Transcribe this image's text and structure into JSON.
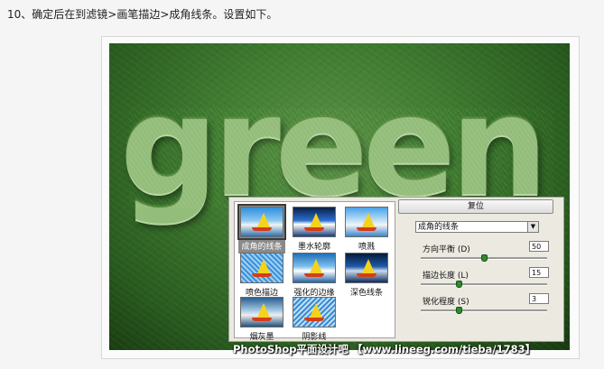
{
  "caption": "10、确定后在到滤镜>画笔描边>成角线条。设置如下。",
  "artwork": {
    "word": "green",
    "colors": {
      "background": "#3f7a30",
      "letters": "#93bd7a"
    }
  },
  "dialog": {
    "thumbnails": [
      {
        "label": "成角的线条",
        "selected": true
      },
      {
        "label": "墨水轮廓",
        "selected": false
      },
      {
        "label": "喷溅",
        "selected": false
      },
      {
        "label": "喷色描边",
        "selected": false
      },
      {
        "label": "强化的边缘",
        "selected": false
      },
      {
        "label": "深色线条",
        "selected": false
      },
      {
        "label": "烟灰墨",
        "selected": false
      },
      {
        "label": "阴影线",
        "selected": false
      }
    ],
    "reset_label": "复位",
    "filter_select_value": "成角的线条",
    "params": [
      {
        "label": "方向平衡 (D)",
        "value": "50",
        "fraction": 0.5
      },
      {
        "label": "描边长度 (L)",
        "value": "15",
        "fraction": 0.3
      },
      {
        "label": "锐化程度 (S)",
        "value": "3",
        "fraction": 0.3
      }
    ]
  },
  "watermark": "PhotoShop平面设计吧 【www.lineeg.com/tieba/1783】"
}
